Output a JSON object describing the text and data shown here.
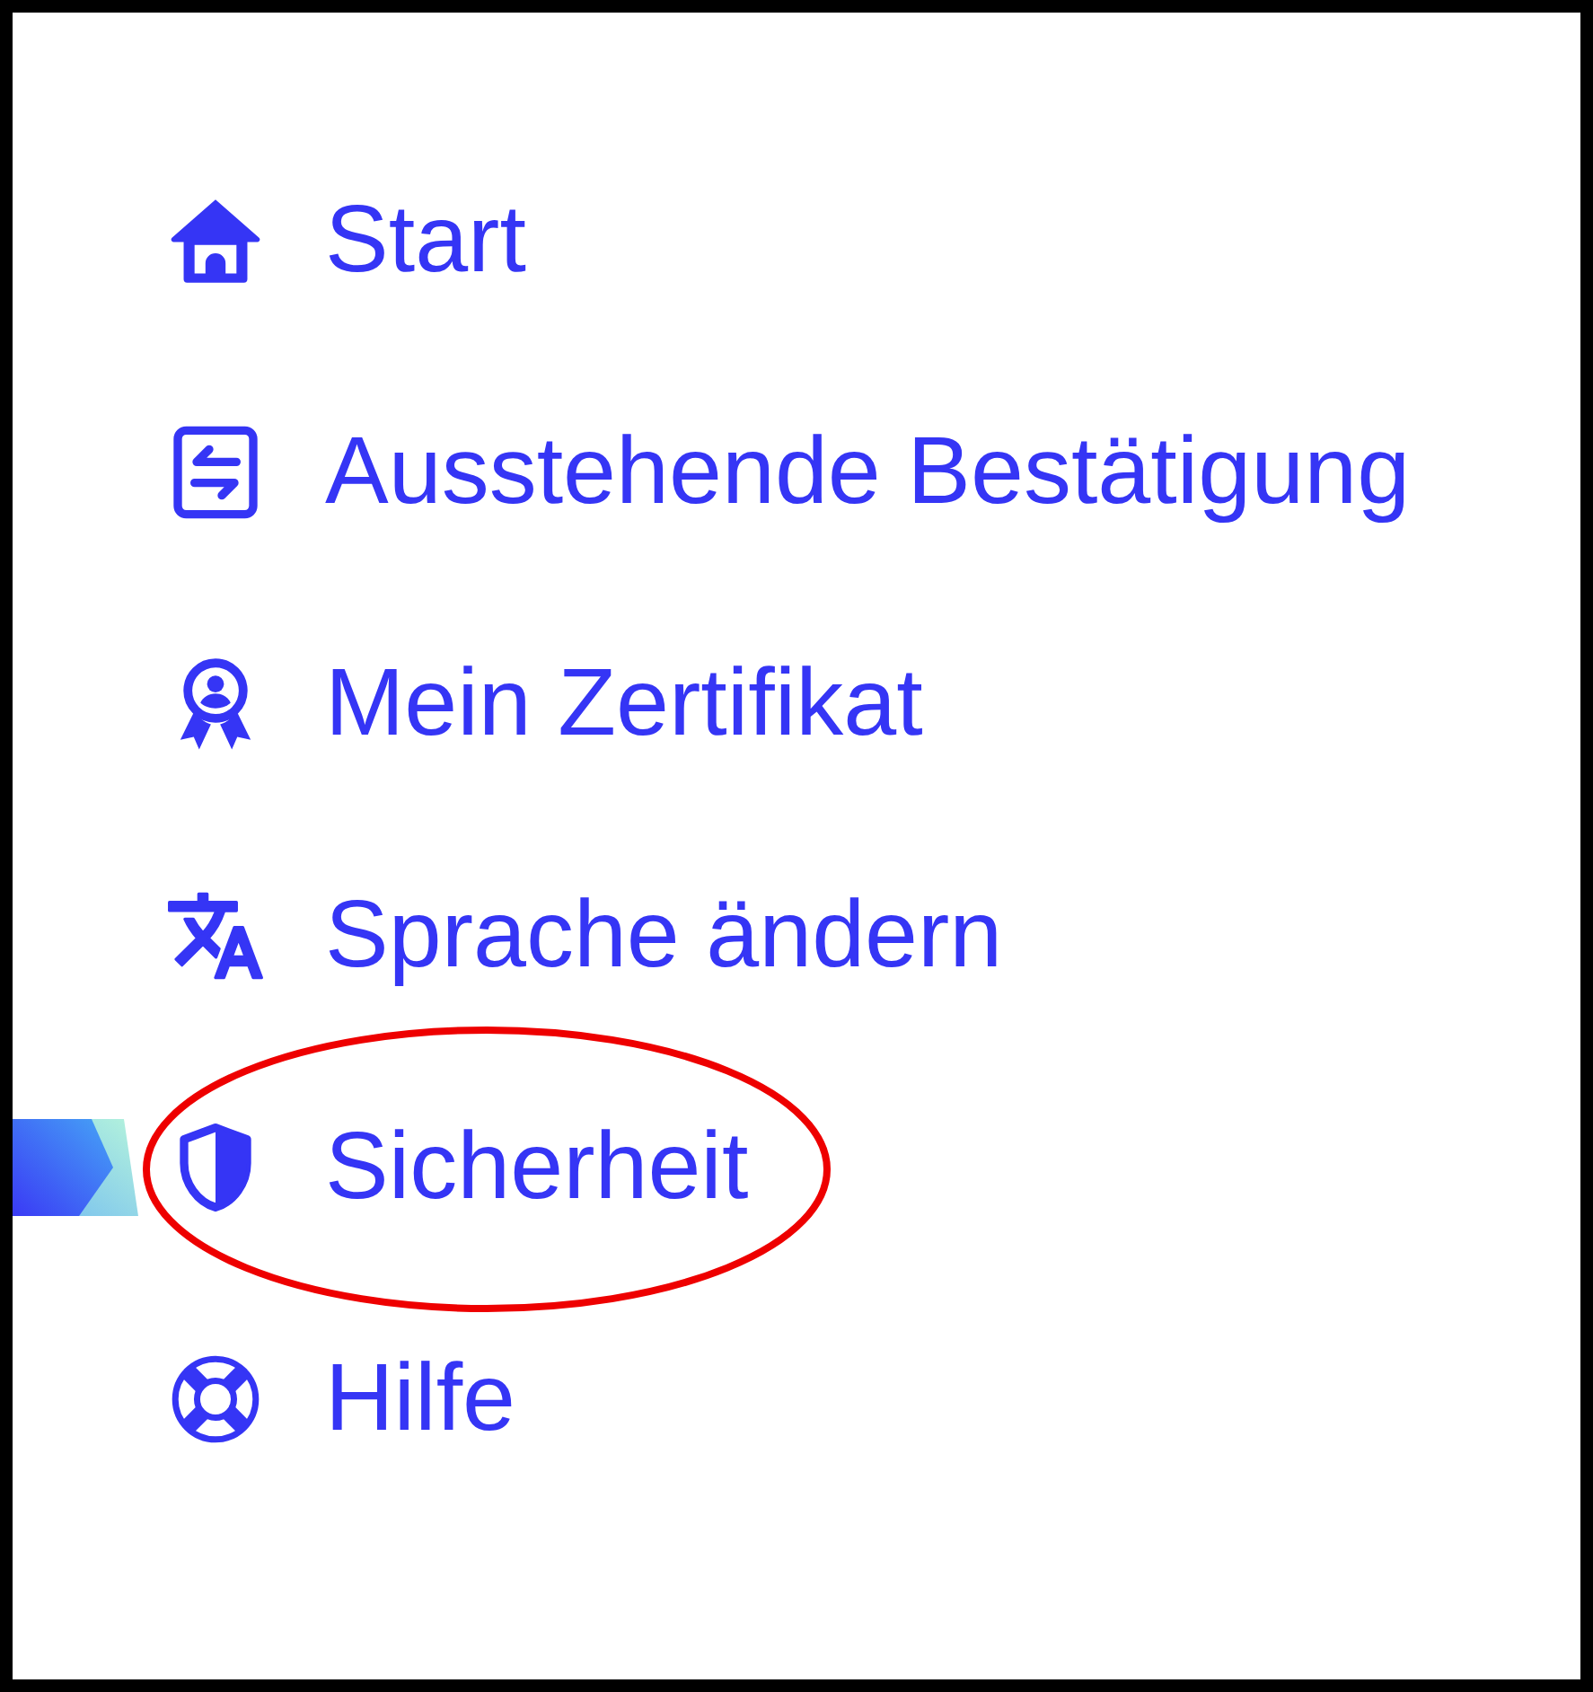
{
  "menu": {
    "items": [
      {
        "label": "Start",
        "selected": false,
        "circled": false
      },
      {
        "label": "Ausstehende Bestätigung",
        "selected": false,
        "circled": false
      },
      {
        "label": "Mein Zertifikat",
        "selected": false,
        "circled": false
      },
      {
        "label": "Sprache ändern",
        "selected": false,
        "circled": false
      },
      {
        "label": "Sicherheit",
        "selected": true,
        "circled": true
      },
      {
        "label": "Hilfe",
        "selected": false,
        "circled": false
      }
    ]
  }
}
